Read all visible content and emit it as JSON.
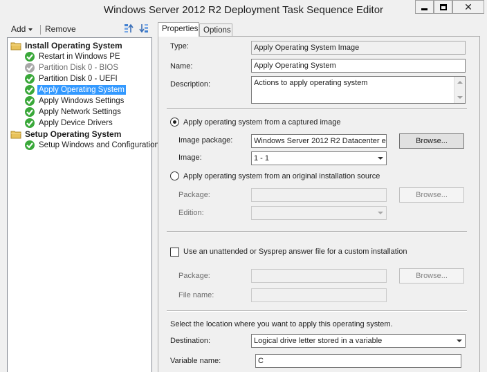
{
  "window": {
    "title": "Windows Server 2012 R2 Deployment Task Sequence Editor"
  },
  "toolbar": {
    "add_label": "Add",
    "remove_label": "Remove"
  },
  "tree": {
    "groups": [
      {
        "label": "Install Operating System",
        "children": [
          {
            "label": "Restart in Windows PE",
            "status": "enabled"
          },
          {
            "label": "Partition Disk 0 - BIOS",
            "status": "disabled"
          },
          {
            "label": "Partition Disk 0 - UEFI",
            "status": "enabled"
          },
          {
            "label": "Apply Operating System",
            "status": "enabled",
            "selected": true
          },
          {
            "label": "Apply Windows Settings",
            "status": "enabled"
          },
          {
            "label": "Apply Network Settings",
            "status": "enabled"
          },
          {
            "label": "Apply Device Drivers",
            "status": "enabled"
          }
        ]
      },
      {
        "label": "Setup Operating System",
        "children": [
          {
            "label": "Setup Windows and Configuration",
            "status": "enabled"
          }
        ]
      }
    ]
  },
  "tabs": {
    "properties": "Properties",
    "options": "Options"
  },
  "props": {
    "type_label": "Type:",
    "type_value": "Apply Operating System Image",
    "name_label": "Name:",
    "name_value": "Apply Operating System",
    "description_label": "Description:",
    "description_value": "Actions to apply operating system",
    "radio_captured_label": "Apply operating system from a captured image",
    "image_package_label": "Image package:",
    "image_package_value": "Windows Server 2012 R2 Datacenter  e",
    "browse_label": "Browse...",
    "image_label": "Image:",
    "image_value": "1 - 1",
    "radio_original_label": "Apply operating system from an original installation source",
    "package_label": "Package:",
    "edition_label": "Edition:",
    "unattend_label": "Use an unattended or Sysprep answer file for a custom installation",
    "file_name_label": "File name:",
    "location_text": "Select the location where you want to apply this operating system.",
    "destination_label": "Destination:",
    "destination_value": "Logical drive letter stored in a variable",
    "variable_name_label": "Variable name:",
    "variable_name_value": "C"
  },
  "colors": {
    "selection": "#3399ff",
    "check_green": "#3aa83a",
    "folder_yellow": "#e8c25a"
  }
}
